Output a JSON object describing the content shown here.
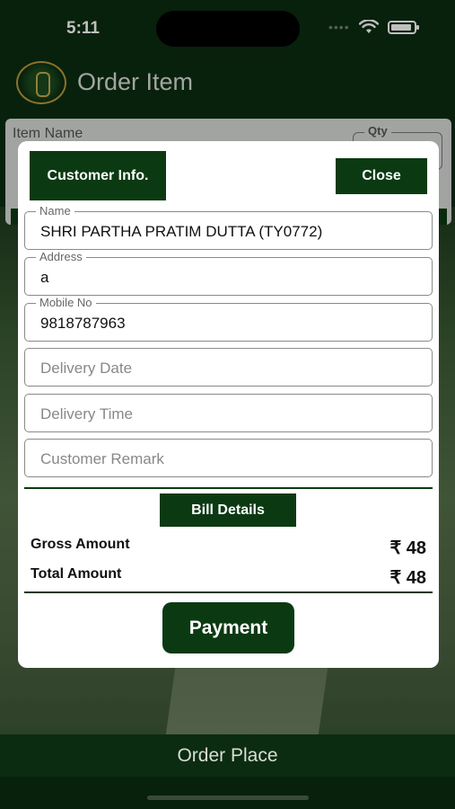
{
  "status": {
    "time": "5:11",
    "dots": "••••"
  },
  "header": {
    "title": "Order Item"
  },
  "order_form": {
    "item_label": "Item Name",
    "qty_label": "Qty"
  },
  "modal": {
    "customer_info_label": "Customer Info.",
    "close_label": "Close",
    "fields": {
      "name": {
        "legend": "Name",
        "value": "SHRI PARTHA PRATIM DUTTA (TY0772)"
      },
      "address": {
        "legend": "Address",
        "value": "a"
      },
      "mobile": {
        "legend": "Mobile No",
        "value": "9818787963"
      },
      "delivery_date": {
        "placeholder": "Delivery Date"
      },
      "delivery_time": {
        "placeholder": "Delivery Time"
      },
      "remark": {
        "placeholder": "Customer Remark"
      }
    },
    "bill_details_label": "Bill Details",
    "gross_amount_label": "Gross Amount",
    "gross_amount_value": "₹ 48",
    "total_amount_label": "Total Amount",
    "total_amount_value": "₹ 48",
    "payment_label": "Payment"
  },
  "footer": {
    "order_place_label": "Order Place"
  },
  "colors": {
    "brand_green": "#0b3a12",
    "header_green": "#0b2c10"
  },
  "icons": {
    "wifi": "wifi-icon",
    "battery": "battery-icon",
    "logo": "club-logo"
  }
}
